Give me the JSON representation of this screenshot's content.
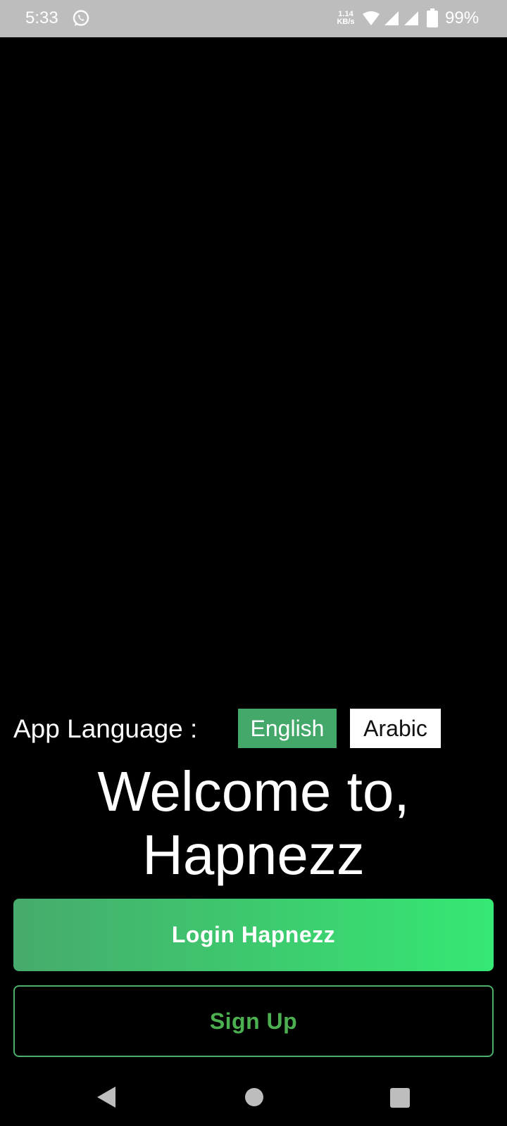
{
  "status_bar": {
    "time": "5:33",
    "net_speed_value": "1.14",
    "net_speed_unit": "KB/s",
    "battery": "99%",
    "icons": [
      "whatsapp-icon",
      "wifi-icon",
      "signal-icon",
      "signal-icon",
      "battery-icon"
    ]
  },
  "language": {
    "label": "App Language :",
    "options": [
      "English",
      "Arabic"
    ],
    "selected": "English"
  },
  "welcome": {
    "line1": "Welcome to,",
    "line2": "Hapnezz"
  },
  "actions": {
    "login_label": "Login Hapnezz",
    "signup_label": "Sign Up"
  },
  "nav": {
    "icons": [
      "back-icon",
      "home-icon",
      "recents-icon"
    ]
  },
  "colors": {
    "accent_green": "#43a86a",
    "gradient_end": "#36e874",
    "signup_text": "#4caf50",
    "background": "#000000",
    "status_bar": "#bdbdbd"
  }
}
